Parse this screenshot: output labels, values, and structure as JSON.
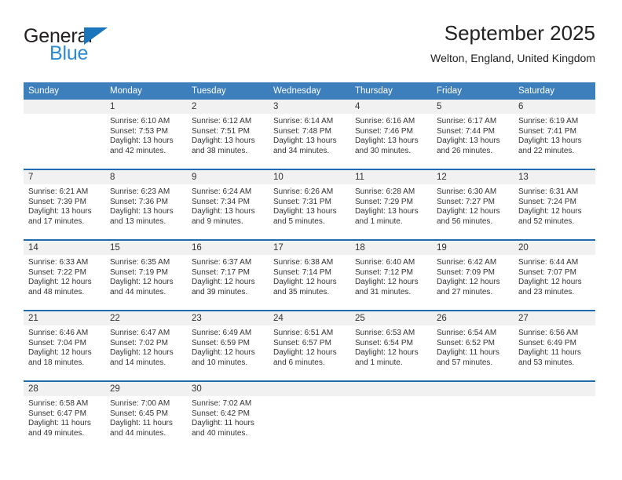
{
  "brand": {
    "name_top": "General",
    "name_bottom": "Blue",
    "triangle_color": "#1b75bb",
    "blue_color": "#2b8ad4",
    "dark_color": "#231f20"
  },
  "header": {
    "title": "September 2025",
    "subtitle": "Welton, England, United Kingdom"
  },
  "theme": {
    "header_bg": "#3d7ebd",
    "week_separator": "#1f6bb0",
    "daynum_bg": "#f1f1f1",
    "text": "#333333"
  },
  "calendar": {
    "weekday_headers": [
      "Sunday",
      "Monday",
      "Tuesday",
      "Wednesday",
      "Thursday",
      "Friday",
      "Saturday"
    ],
    "weeks": [
      [
        {
          "day": "",
          "lines": [
            "",
            "",
            "",
            ""
          ]
        },
        {
          "day": "1",
          "lines": [
            "Sunrise: 6:10 AM",
            "Sunset: 7:53 PM",
            "Daylight: 13 hours",
            "and 42 minutes."
          ]
        },
        {
          "day": "2",
          "lines": [
            "Sunrise: 6:12 AM",
            "Sunset: 7:51 PM",
            "Daylight: 13 hours",
            "and 38 minutes."
          ]
        },
        {
          "day": "3",
          "lines": [
            "Sunrise: 6:14 AM",
            "Sunset: 7:48 PM",
            "Daylight: 13 hours",
            "and 34 minutes."
          ]
        },
        {
          "day": "4",
          "lines": [
            "Sunrise: 6:16 AM",
            "Sunset: 7:46 PM",
            "Daylight: 13 hours",
            "and 30 minutes."
          ]
        },
        {
          "day": "5",
          "lines": [
            "Sunrise: 6:17 AM",
            "Sunset: 7:44 PM",
            "Daylight: 13 hours",
            "and 26 minutes."
          ]
        },
        {
          "day": "6",
          "lines": [
            "Sunrise: 6:19 AM",
            "Sunset: 7:41 PM",
            "Daylight: 13 hours",
            "and 22 minutes."
          ]
        }
      ],
      [
        {
          "day": "7",
          "lines": [
            "Sunrise: 6:21 AM",
            "Sunset: 7:39 PM",
            "Daylight: 13 hours",
            "and 17 minutes."
          ]
        },
        {
          "day": "8",
          "lines": [
            "Sunrise: 6:23 AM",
            "Sunset: 7:36 PM",
            "Daylight: 13 hours",
            "and 13 minutes."
          ]
        },
        {
          "day": "9",
          "lines": [
            "Sunrise: 6:24 AM",
            "Sunset: 7:34 PM",
            "Daylight: 13 hours",
            "and 9 minutes."
          ]
        },
        {
          "day": "10",
          "lines": [
            "Sunrise: 6:26 AM",
            "Sunset: 7:31 PM",
            "Daylight: 13 hours",
            "and 5 minutes."
          ]
        },
        {
          "day": "11",
          "lines": [
            "Sunrise: 6:28 AM",
            "Sunset: 7:29 PM",
            "Daylight: 13 hours",
            "and 1 minute."
          ]
        },
        {
          "day": "12",
          "lines": [
            "Sunrise: 6:30 AM",
            "Sunset: 7:27 PM",
            "Daylight: 12 hours",
            "and 56 minutes."
          ]
        },
        {
          "day": "13",
          "lines": [
            "Sunrise: 6:31 AM",
            "Sunset: 7:24 PM",
            "Daylight: 12 hours",
            "and 52 minutes."
          ]
        }
      ],
      [
        {
          "day": "14",
          "lines": [
            "Sunrise: 6:33 AM",
            "Sunset: 7:22 PM",
            "Daylight: 12 hours",
            "and 48 minutes."
          ]
        },
        {
          "day": "15",
          "lines": [
            "Sunrise: 6:35 AM",
            "Sunset: 7:19 PM",
            "Daylight: 12 hours",
            "and 44 minutes."
          ]
        },
        {
          "day": "16",
          "lines": [
            "Sunrise: 6:37 AM",
            "Sunset: 7:17 PM",
            "Daylight: 12 hours",
            "and 39 minutes."
          ]
        },
        {
          "day": "17",
          "lines": [
            "Sunrise: 6:38 AM",
            "Sunset: 7:14 PM",
            "Daylight: 12 hours",
            "and 35 minutes."
          ]
        },
        {
          "day": "18",
          "lines": [
            "Sunrise: 6:40 AM",
            "Sunset: 7:12 PM",
            "Daylight: 12 hours",
            "and 31 minutes."
          ]
        },
        {
          "day": "19",
          "lines": [
            "Sunrise: 6:42 AM",
            "Sunset: 7:09 PM",
            "Daylight: 12 hours",
            "and 27 minutes."
          ]
        },
        {
          "day": "20",
          "lines": [
            "Sunrise: 6:44 AM",
            "Sunset: 7:07 PM",
            "Daylight: 12 hours",
            "and 23 minutes."
          ]
        }
      ],
      [
        {
          "day": "21",
          "lines": [
            "Sunrise: 6:46 AM",
            "Sunset: 7:04 PM",
            "Daylight: 12 hours",
            "and 18 minutes."
          ]
        },
        {
          "day": "22",
          "lines": [
            "Sunrise: 6:47 AM",
            "Sunset: 7:02 PM",
            "Daylight: 12 hours",
            "and 14 minutes."
          ]
        },
        {
          "day": "23",
          "lines": [
            "Sunrise: 6:49 AM",
            "Sunset: 6:59 PM",
            "Daylight: 12 hours",
            "and 10 minutes."
          ]
        },
        {
          "day": "24",
          "lines": [
            "Sunrise: 6:51 AM",
            "Sunset: 6:57 PM",
            "Daylight: 12 hours",
            "and 6 minutes."
          ]
        },
        {
          "day": "25",
          "lines": [
            "Sunrise: 6:53 AM",
            "Sunset: 6:54 PM",
            "Daylight: 12 hours",
            "and 1 minute."
          ]
        },
        {
          "day": "26",
          "lines": [
            "Sunrise: 6:54 AM",
            "Sunset: 6:52 PM",
            "Daylight: 11 hours",
            "and 57 minutes."
          ]
        },
        {
          "day": "27",
          "lines": [
            "Sunrise: 6:56 AM",
            "Sunset: 6:49 PM",
            "Daylight: 11 hours",
            "and 53 minutes."
          ]
        }
      ],
      [
        {
          "day": "28",
          "lines": [
            "Sunrise: 6:58 AM",
            "Sunset: 6:47 PM",
            "Daylight: 11 hours",
            "and 49 minutes."
          ]
        },
        {
          "day": "29",
          "lines": [
            "Sunrise: 7:00 AM",
            "Sunset: 6:45 PM",
            "Daylight: 11 hours",
            "and 44 minutes."
          ]
        },
        {
          "day": "30",
          "lines": [
            "Sunrise: 7:02 AM",
            "Sunset: 6:42 PM",
            "Daylight: 11 hours",
            "and 40 minutes."
          ]
        },
        {
          "day": "",
          "lines": [
            "",
            "",
            "",
            ""
          ]
        },
        {
          "day": "",
          "lines": [
            "",
            "",
            "",
            ""
          ]
        },
        {
          "day": "",
          "lines": [
            "",
            "",
            "",
            ""
          ]
        },
        {
          "day": "",
          "lines": [
            "",
            "",
            "",
            ""
          ]
        }
      ]
    ]
  }
}
